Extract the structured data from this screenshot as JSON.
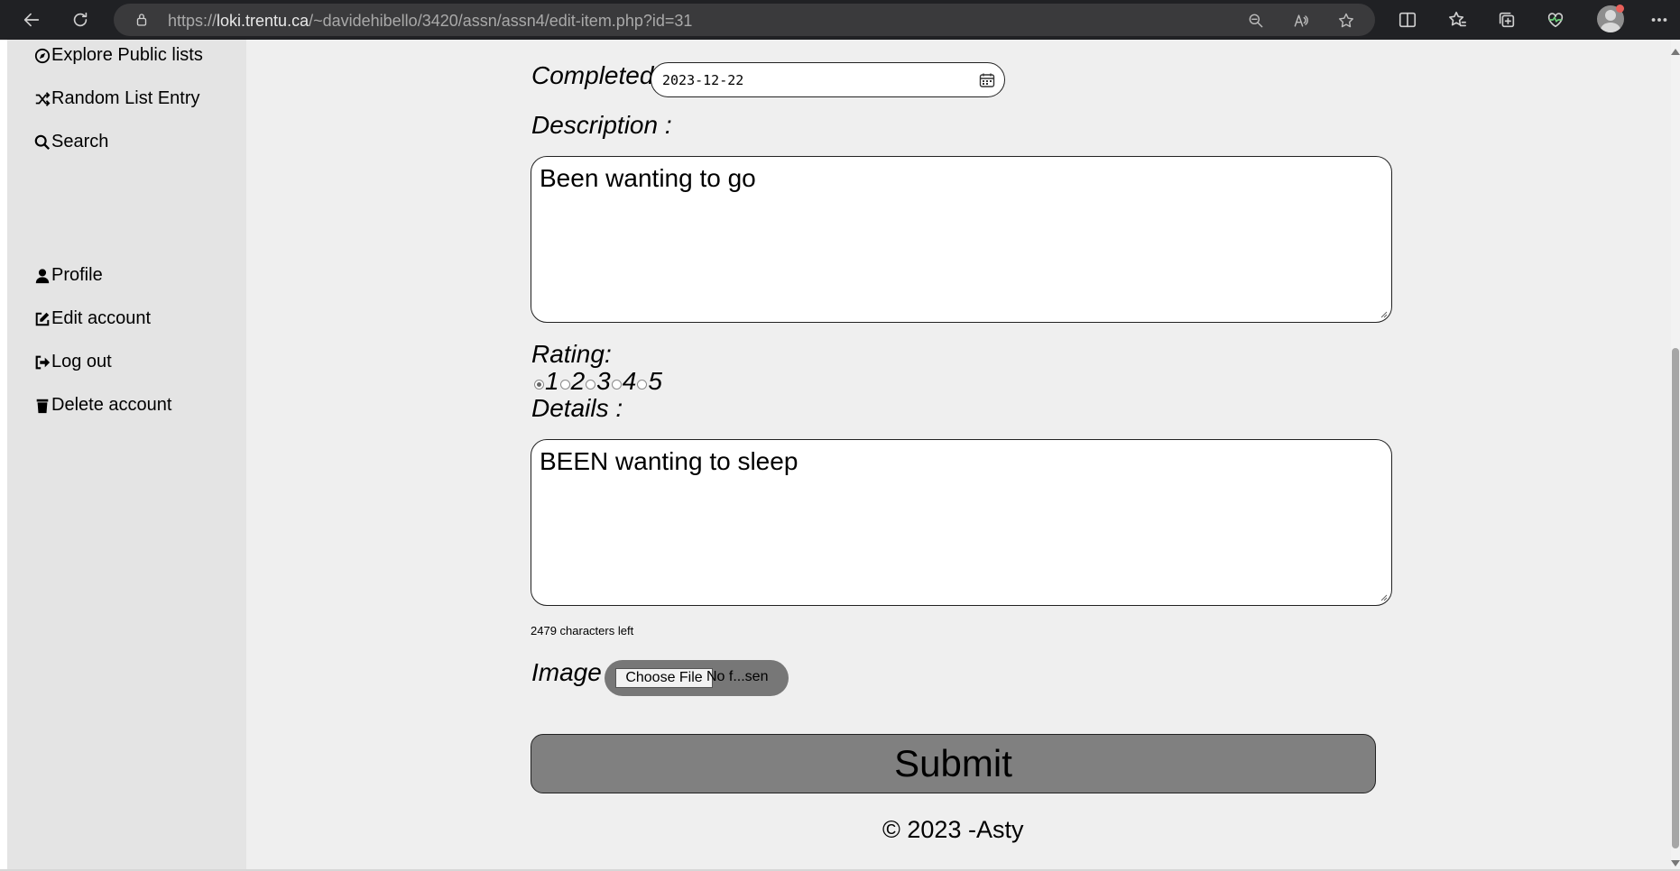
{
  "browser": {
    "url_prefix": "https://",
    "url_host": "loki.trentu.ca",
    "url_path": "/~davidehibello/3420/assn/assn4/edit-item.php?id=31",
    "icons": [
      "back-icon",
      "refresh-icon",
      "lock-icon",
      "zoom-out-icon",
      "read-aloud-icon",
      "favorite-star-icon",
      "split-screen-icon",
      "favorites-icon",
      "collections-icon",
      "health-icon",
      "profile-avatar",
      "more-icon"
    ]
  },
  "sidebar": {
    "items": [
      {
        "label": "Explore Public lists",
        "icon": "compass-icon"
      },
      {
        "label": "Random List Entry",
        "icon": "shuffle-icon"
      },
      {
        "label": "Search",
        "icon": "search-icon"
      },
      {
        "label": "Profile",
        "icon": "user-icon"
      },
      {
        "label": "Edit account",
        "icon": "edit-icon"
      },
      {
        "label": "Log out",
        "icon": "logout-icon"
      },
      {
        "label": "Delete account",
        "icon": "trash-icon"
      }
    ]
  },
  "form": {
    "completed_label": "Completed",
    "completed_value": "2023-12-22",
    "description_label": "Description :",
    "description_value": "Been wanting to go",
    "rating_label": "Rating:",
    "rating_options": [
      "1",
      "2",
      "3",
      "4",
      "5"
    ],
    "rating_selected": "1",
    "details_label": "Details :",
    "details_value": "BEEN wanting to sleep",
    "chars_left": "2479 characters left",
    "image_label": "Image",
    "choose_file": "Choose File",
    "file_status": "No f...sen",
    "submit_label": "Submit"
  },
  "footer": {
    "text": "© 2023 -Asty"
  },
  "colors": {
    "page_bg": "#efefef",
    "sidebar_bg": "#e4e4e4",
    "button_bg": "#808080",
    "chrome_bg": "#202124"
  }
}
